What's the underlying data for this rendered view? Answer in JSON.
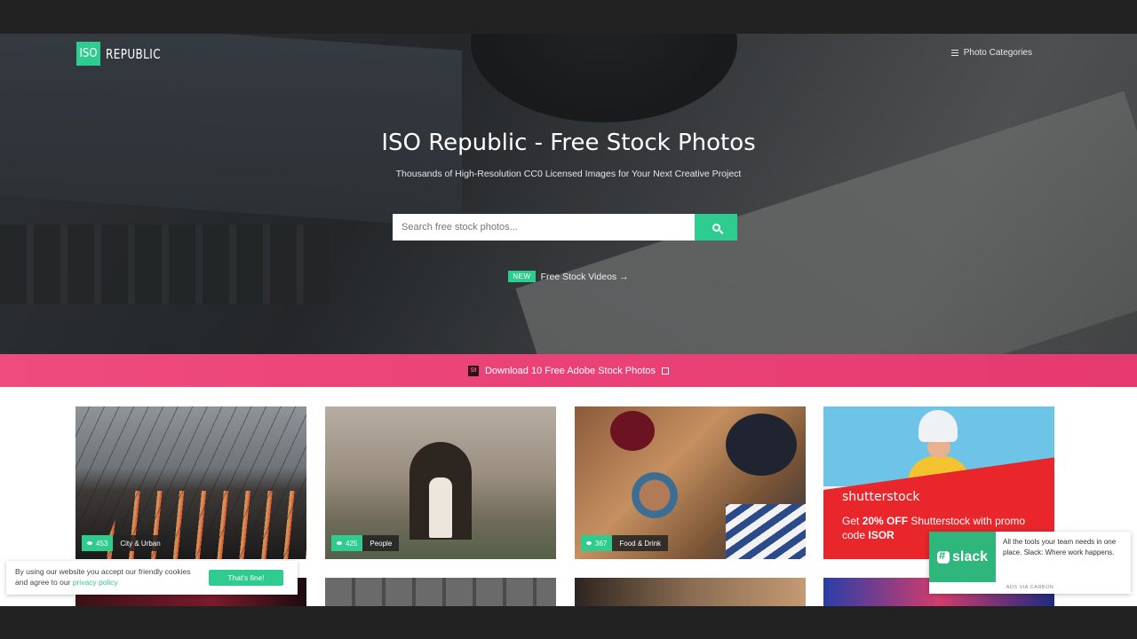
{
  "header": {
    "logo_box": "ISO",
    "logo_word": "REPUBLIC",
    "categories_label": "Photo Categories"
  },
  "hero": {
    "title": "ISO Republic - Free Stock Photos",
    "subtitle": "Thousands of High-Resolution CC0 Licensed Images for Your Next Creative Project",
    "search_placeholder": "Search free stock photos...",
    "new_badge": "NEW",
    "videos_link": "Free Stock Videos →"
  },
  "promo": {
    "adobe_icon_text": "St",
    "label": "Download 10 Free Adobe Stock Photos"
  },
  "cards": [
    {
      "count": "453",
      "category": "City & Urban"
    },
    {
      "count": "425",
      "category": "People"
    },
    {
      "count": "367",
      "category": "Food & Drink"
    }
  ],
  "sponsor_card": {
    "brand": "shutterstock",
    "offer_prefix": "Get ",
    "offer_bold": "20% OFF",
    "offer_suffix": " Shutterstock with promo code ",
    "offer_code": "ISOR"
  },
  "cookie": {
    "message": "By using our website you accept our friendly cookies and agree to our ",
    "link": "privacy policy",
    "button": "That's fine!"
  },
  "ad": {
    "brand": "slack",
    "copy": "All the tools your team needs in one place. Slack: Where work happens.",
    "via": "ADS VIA CARBON"
  },
  "colors": {
    "accent": "#2ecc8f",
    "promo": "#e8406f",
    "slack": "#2eb67d",
    "shutterstock": "#e8262b"
  }
}
